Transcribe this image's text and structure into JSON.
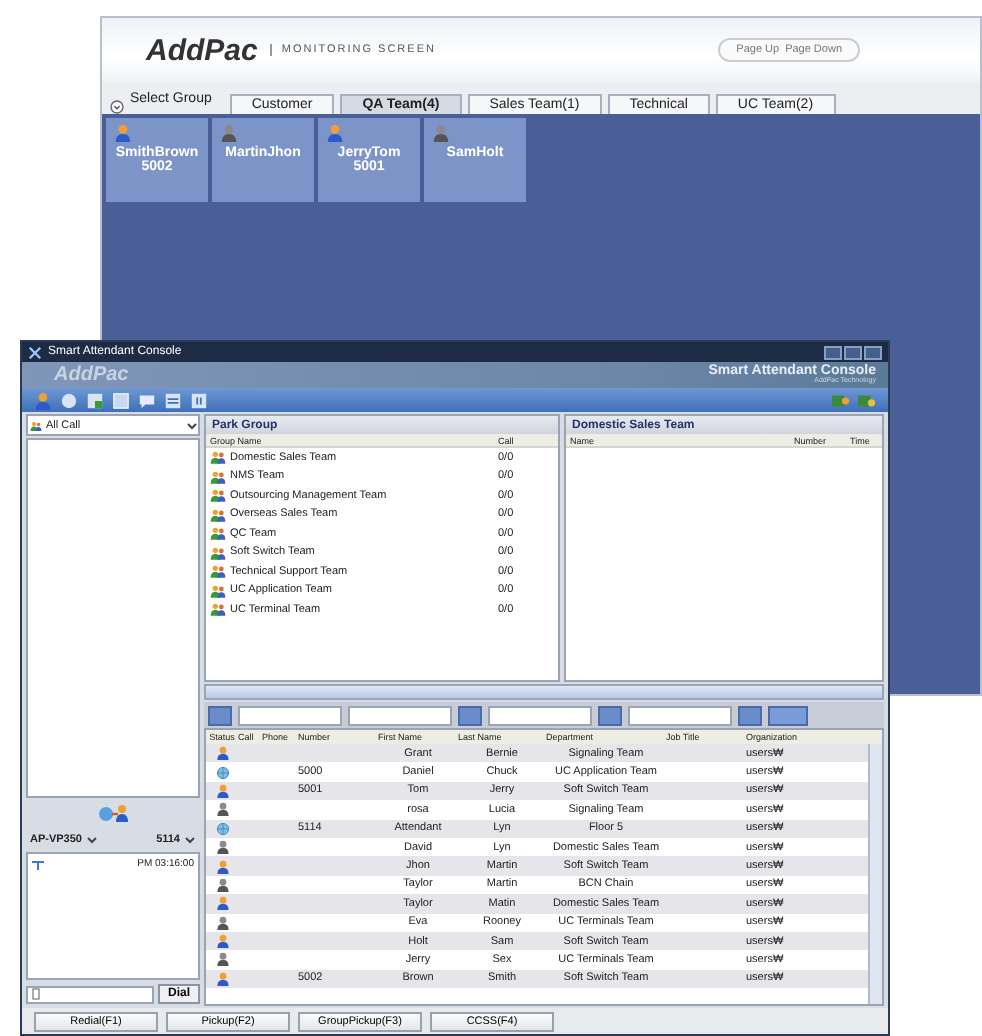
{
  "monitor": {
    "logo": "AddPac",
    "subtitle": "MONITORING SCREEN",
    "paging": [
      "Page Up",
      "Page Down"
    ],
    "select_group": "Select Group",
    "tabs": [
      {
        "label": "Customer",
        "selected": false
      },
      {
        "label": "QA Team(4)",
        "selected": true
      },
      {
        "label": "Sales Team(1)",
        "selected": false
      },
      {
        "label": "Technical",
        "selected": false
      },
      {
        "label": "UC Team(2)",
        "selected": false
      }
    ],
    "agents": [
      {
        "name": "SmithBrown",
        "extension": "5002",
        "kind": "online"
      },
      {
        "name": "MartinJhon",
        "kind": "offline"
      },
      {
        "name": "JerryTom",
        "extension": "5001",
        "kind": "online"
      },
      {
        "name": "SamHolt",
        "kind": "offline"
      }
    ]
  },
  "console": {
    "title": "Smart Attendant Console",
    "brand": "AddPac",
    "brand_title": "Smart Attendant Console",
    "brand_tagline": "AddPac Technology",
    "call_filter": "All Call",
    "device": "AP-VP350",
    "extension": "5114",
    "call_log": [
      {
        "time": "PM 03:16:00"
      }
    ],
    "dial_button": "Dial",
    "park_group": {
      "title": "Park Group",
      "columns": [
        "Group Name",
        "Call"
      ],
      "rows": [
        {
          "name": "Domestic Sales Team",
          "calls": "0/0"
        },
        {
          "name": "NMS Team",
          "calls": "0/0"
        },
        {
          "name": "Outsourcing Management Team",
          "calls": "0/0"
        },
        {
          "name": "Overseas Sales Team",
          "calls": "0/0"
        },
        {
          "name": "QC Team",
          "calls": "0/0"
        },
        {
          "name": "Soft Switch Team",
          "calls": "0/0"
        },
        {
          "name": "Technical Support Team",
          "calls": "0/0"
        },
        {
          "name": "UC Application Team",
          "calls": "0/0"
        },
        {
          "name": "UC Terminal Team",
          "calls": "0/0"
        }
      ]
    },
    "team_panel": {
      "title": "Domestic Sales Team",
      "columns": [
        "Name",
        "Number",
        "Time"
      ]
    },
    "directory": {
      "columns": [
        "Status",
        "Call",
        "Phone",
        "Number",
        "First Name",
        "Last Name",
        "Department",
        "Job Title",
        "Organization"
      ],
      "rows": [
        {
          "kind": "online",
          "number": "",
          "first_name": "Grant",
          "last_name": "Bernie",
          "department": "Signaling Team",
          "organization": "users₩"
        },
        {
          "kind": "attendant",
          "number": "5000",
          "first_name": "Daniel",
          "last_name": "Chuck",
          "department": "UC Application Team",
          "organization": "users₩"
        },
        {
          "kind": "online",
          "number": "5001",
          "first_name": "Tom",
          "last_name": "Jerry",
          "department": "Soft Switch Team",
          "organization": "users₩"
        },
        {
          "kind": "offline",
          "number": "",
          "first_name": "rosa",
          "last_name": "Lucia",
          "department": "Signaling Team",
          "organization": "users₩"
        },
        {
          "kind": "attendant",
          "number": "5114",
          "first_name": "Attendant",
          "last_name": "Lyn",
          "department": "Floor 5",
          "organization": "users₩"
        },
        {
          "kind": "offline",
          "number": "",
          "first_name": "David",
          "last_name": "Lyn",
          "department": "Domestic Sales Team",
          "organization": "users₩"
        },
        {
          "kind": "online",
          "number": "",
          "first_name": "Jhon",
          "last_name": "Martin",
          "department": "Soft Switch Team",
          "organization": "users₩"
        },
        {
          "kind": "offline",
          "number": "",
          "first_name": "Taylor",
          "last_name": "Martin",
          "department": "BCN Chain",
          "organization": "users₩"
        },
        {
          "kind": "online",
          "number": "",
          "first_name": "Taylor",
          "last_name": "Matin",
          "department": "Domestic Sales Team",
          "organization": "users₩"
        },
        {
          "kind": "offline",
          "number": "",
          "first_name": "Eva",
          "last_name": "Rooney",
          "department": "UC Terminals Team",
          "organization": "users₩"
        },
        {
          "kind": "online",
          "number": "",
          "first_name": "Holt",
          "last_name": "Sam",
          "department": "Soft Switch Team",
          "organization": "users₩"
        },
        {
          "kind": "offline",
          "number": "",
          "first_name": "Jerry",
          "last_name": "Sex",
          "department": "UC Terminals Team",
          "organization": "users₩"
        },
        {
          "kind": "online",
          "number": "5002",
          "first_name": "Brown",
          "last_name": "Smith",
          "department": "Soft Switch Team",
          "organization": "users₩"
        }
      ]
    },
    "function_buttons": [
      "Redial(F1)",
      "Pickup(F2)",
      "GroupPickup(F3)",
      "CCSS(F4)"
    ]
  }
}
